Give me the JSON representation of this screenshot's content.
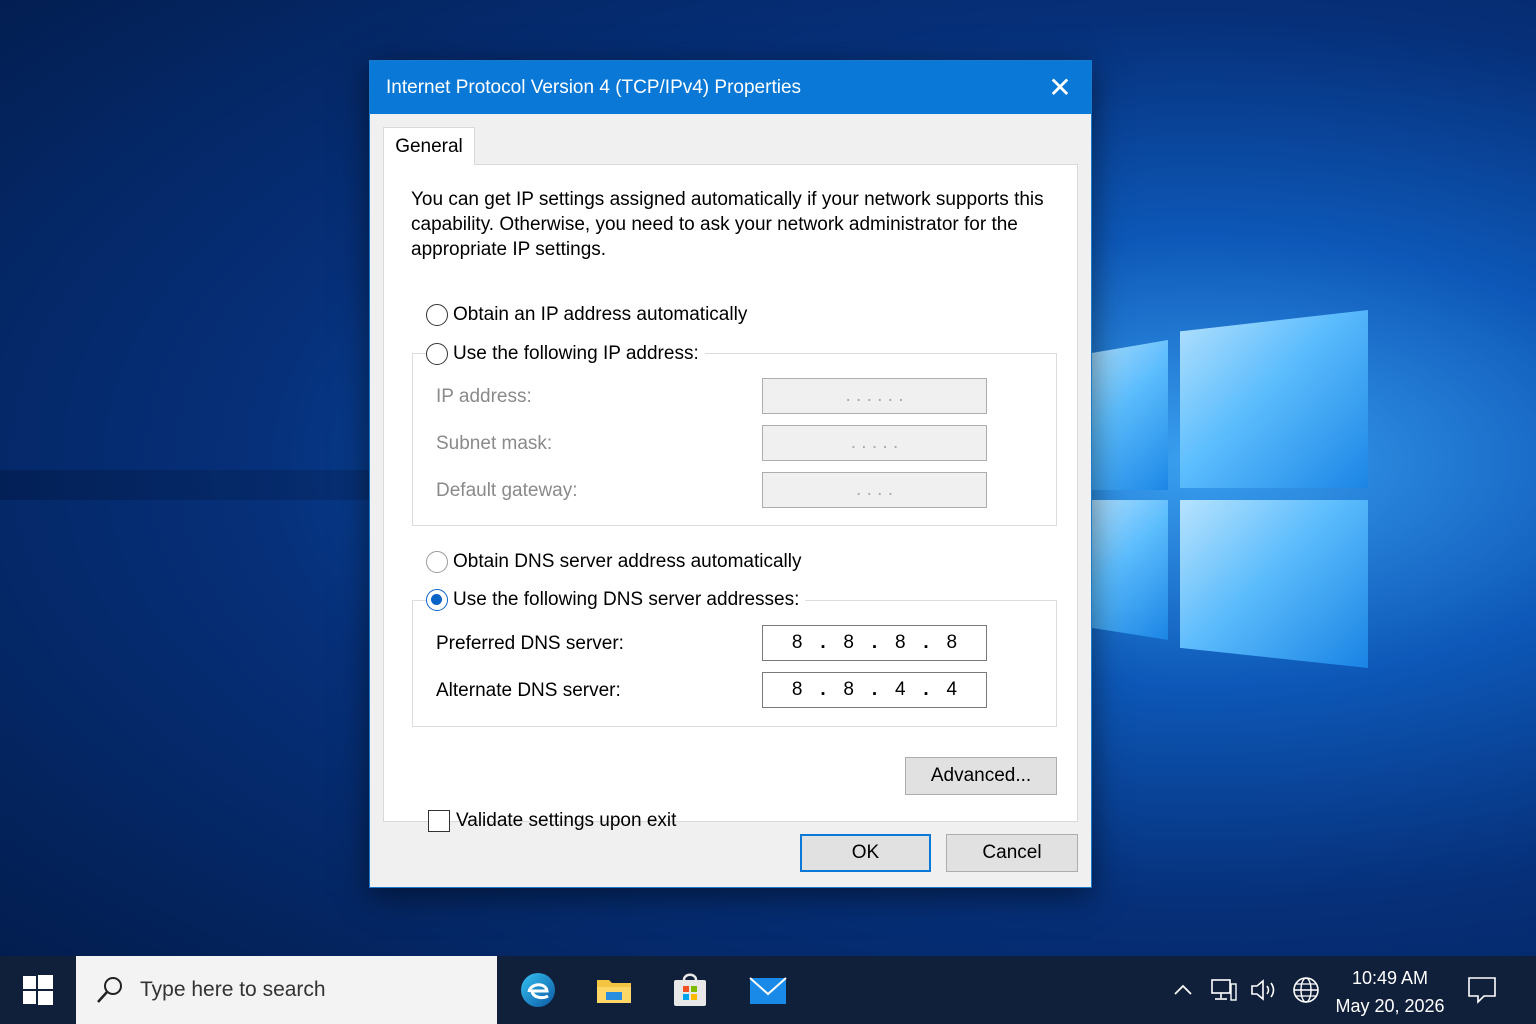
{
  "dialog": {
    "title": "Internet Protocol Version 4 (TCP/IPv4) Properties",
    "close_glyph": "✕",
    "tab_label": "General",
    "intro_text": "You can get IP settings assigned automatically if your network supports this capability. Otherwise, you need to ask your network administrator for the appropriate IP settings.",
    "ip_section": {
      "auto_label": "Obtain an IP address automatically",
      "manual_label": "Use the following IP address:",
      "fields": [
        {
          "label": "IP address:",
          "value": ". . . . . ."
        },
        {
          "label": "Subnet mask:",
          "value": ". . . . ."
        },
        {
          "label": "Default gateway:",
          "value": ". . . ."
        }
      ]
    },
    "dns_section": {
      "auto_label": "Obtain DNS server address automatically",
      "manual_label": "Use the following DNS server addresses:",
      "selected": "manual",
      "preferred": {
        "label": "Preferred DNS server:",
        "octets": [
          "8",
          "8",
          "8",
          "8"
        ]
      },
      "alternate": {
        "label": "Alternate DNS server:",
        "octets": [
          "8",
          "8",
          "4",
          "4"
        ]
      }
    },
    "validate_label": "Validate settings upon exit",
    "validate_checked": false,
    "advanced_label": "Advanced...",
    "ok_label": "OK",
    "cancel_label": "Cancel"
  },
  "taskbar": {
    "search_placeholder": "Type here to search",
    "pinned": [
      "edge-icon",
      "file-explorer-icon",
      "store-icon",
      "mail-icon"
    ],
    "tray_icons": [
      "chevron-up-icon",
      "network-icon",
      "volume-icon",
      "language-icon"
    ],
    "time": "10:49 AM",
    "date": "May 20, 2026"
  },
  "colors": {
    "accent": "#0a78d7",
    "taskbar": "#10203a"
  }
}
